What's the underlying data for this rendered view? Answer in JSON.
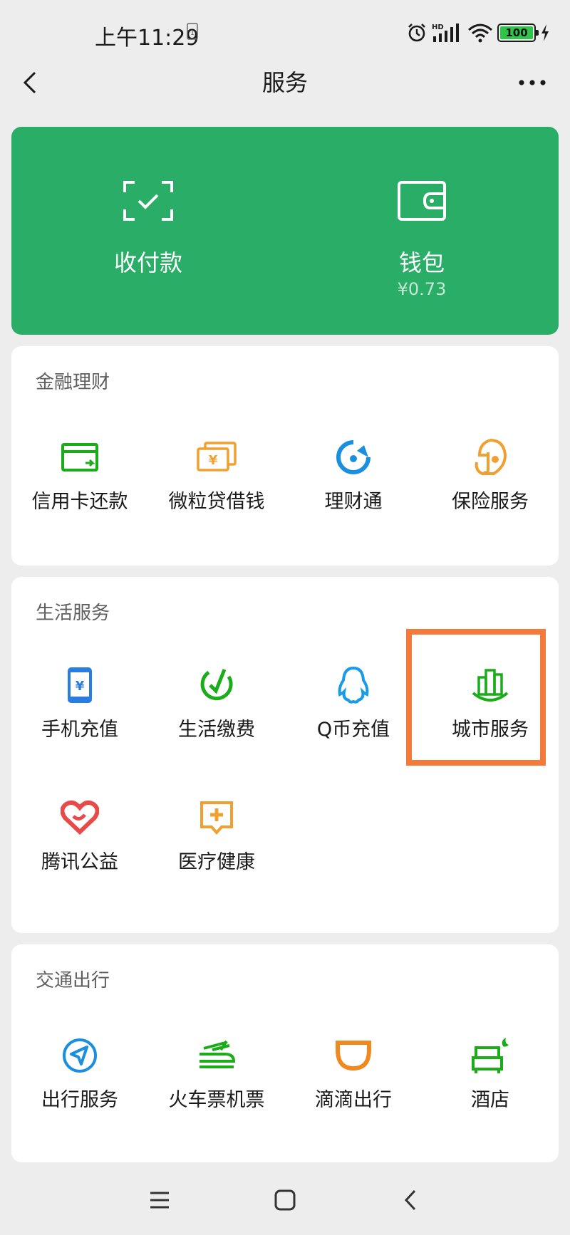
{
  "status_bar": {
    "time": "上午11:29",
    "signal_label": "HD",
    "battery": "100"
  },
  "nav": {
    "title": "服务",
    "back_icon": "chevron-left-icon",
    "more_icon": "more-dots-icon"
  },
  "top_card": {
    "pay": {
      "label": "收付款",
      "icon": "scan-check-icon"
    },
    "wallet": {
      "label": "钱包",
      "balance": "¥0.73",
      "icon": "wallet-icon"
    },
    "color": "#2aae67"
  },
  "sections": {
    "finance": {
      "title": "金融理财",
      "items": [
        {
          "label": "信用卡还款",
          "icon": "credit-card-icon",
          "color": "#1aad19"
        },
        {
          "label": "微粒贷借钱",
          "icon": "cash-icon",
          "color": "#f0a030"
        },
        {
          "label": "理财通",
          "icon": "wealth-icon",
          "color": "#1a8fe0"
        },
        {
          "label": "保险服务",
          "icon": "insurance-umbrella-icon",
          "color": "#f0a030"
        }
      ]
    },
    "life": {
      "title": "生活服务",
      "items": [
        {
          "label": "手机充值",
          "icon": "phone-topup-icon",
          "color": "#2a7de0"
        },
        {
          "label": "生活缴费",
          "icon": "utility-check-icon",
          "color": "#1aad19"
        },
        {
          "label": "Q币充值",
          "icon": "qq-penguin-icon",
          "color": "#1a9be8"
        },
        {
          "label": "城市服务",
          "icon": "city-buildings-icon",
          "color": "#1aad19"
        },
        {
          "label": "腾讯公益",
          "icon": "charity-heart-icon",
          "color": "#e84a4a"
        },
        {
          "label": "医疗健康",
          "icon": "medical-cross-icon",
          "color": "#f0a030"
        }
      ]
    },
    "transport": {
      "title": "交通出行",
      "items": [
        {
          "label": "出行服务",
          "icon": "navigation-icon",
          "color": "#1a8fe0"
        },
        {
          "label": "火车票机票",
          "icon": "train-icon",
          "color": "#1aad19"
        },
        {
          "label": "滴滴出行",
          "icon": "didi-icon",
          "color": "#f08a20"
        },
        {
          "label": "酒店",
          "icon": "hotel-bed-icon",
          "color": "#1aad19"
        }
      ]
    }
  },
  "highlight_color": "#f47a3c",
  "system_nav": {
    "menu_icon": "menu-lines-icon",
    "home_icon": "home-square-icon",
    "back_icon": "back-chevron-icon"
  }
}
